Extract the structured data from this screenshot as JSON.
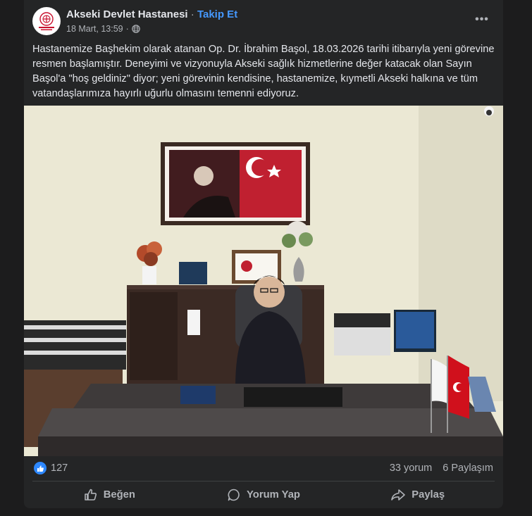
{
  "post": {
    "page_name": "Akseki Devlet Hastanesi",
    "separator": "·",
    "follow_label": "Takip Et",
    "date": "18 Mart, 13:59",
    "date_separator": "·",
    "privacy_icon": "globe-icon",
    "more_icon": "more-options-icon",
    "more_label": "•••",
    "text": "Hastanemize Başhekim olarak atanan Op. Dr. İbrahim Başol, 18.03.2026 tarihi itibarıyla yeni görevine resmen başlamıştır. Deneyimi ve vizyonuyla Akseki sağlık hizmetlerine değer katacak olan Sayın Başol'a \"hoş geldiniz\" diyor; yeni görevinin kendisine, hastanemize, kıymetli Akseki halkına ve tüm vatandaşlarımıza hayırlı uğurlu olmasını temenni ediyoruz."
  },
  "stats": {
    "reaction_icon": "like-reaction-icon",
    "like_count": "127",
    "comments": "33 yorum",
    "shares": "6 Paylaşım"
  },
  "actions": {
    "like_label": "Beğen",
    "comment_label": "Yorum Yap",
    "share_label": "Paylaş"
  },
  "colors": {
    "background": "#1c1c1d",
    "card": "#242526",
    "primary_text": "#e4e6eb",
    "secondary_text": "#b0b3b8",
    "accent": "#2d88ff",
    "follow": "#4599ff"
  }
}
